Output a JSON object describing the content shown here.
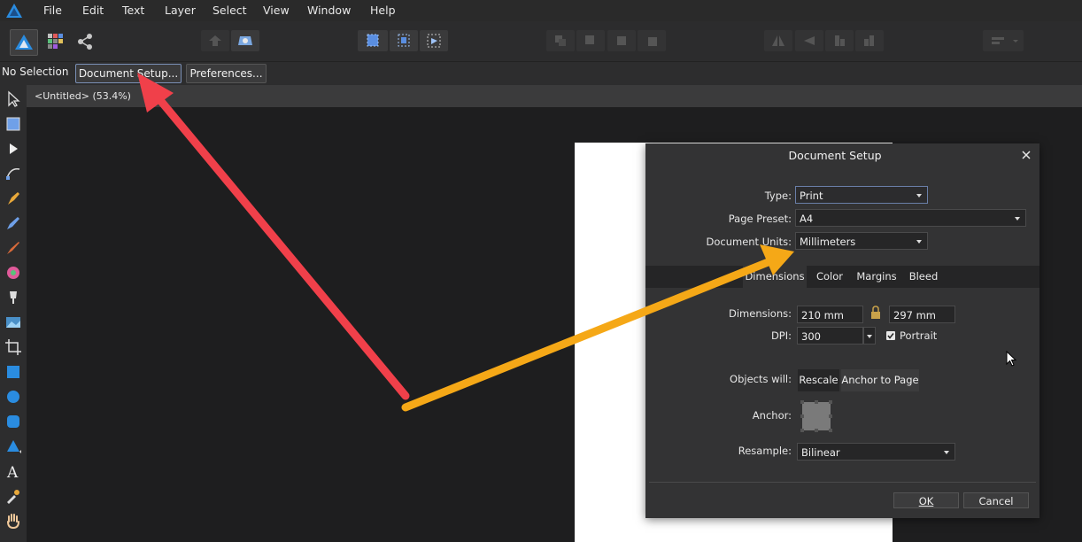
{
  "app": {
    "accent": "#2a8ce0"
  },
  "menu": {
    "items": [
      "File",
      "Edit",
      "Text",
      "Layer",
      "Select",
      "View",
      "Window",
      "Help"
    ]
  },
  "context": {
    "no_selection": "No Selection",
    "document_setup": "Document Setup...",
    "preferences": "Preferences..."
  },
  "document_tab": {
    "title": "<Untitled> (53.4%)"
  },
  "dialog": {
    "title": "Document Setup",
    "type_label": "Type:",
    "type_value": "Print",
    "preset_label": "Page Preset:",
    "preset_value": "A4",
    "units_label": "Document Units:",
    "units_value": "Millimeters",
    "tabs": [
      "Dimensions",
      "Color",
      "Margins",
      "Bleed"
    ],
    "dimensions_label": "Dimensions:",
    "width": "210 mm",
    "height": "297 mm",
    "dpi_label": "DPI:",
    "dpi_value": "300",
    "portrait_label": "Portrait",
    "portrait_checked": true,
    "objects_label": "Objects will:",
    "objects_options": [
      "Rescale",
      "Anchor to Page"
    ],
    "anchor_label": "Anchor:",
    "resample_label": "Resample:",
    "resample_value": "Bilinear",
    "ok": "OK",
    "cancel": "Cancel"
  },
  "annotations": {
    "red_arrow_color": "#f0404a",
    "orange_arrow_color": "#f5a817"
  }
}
